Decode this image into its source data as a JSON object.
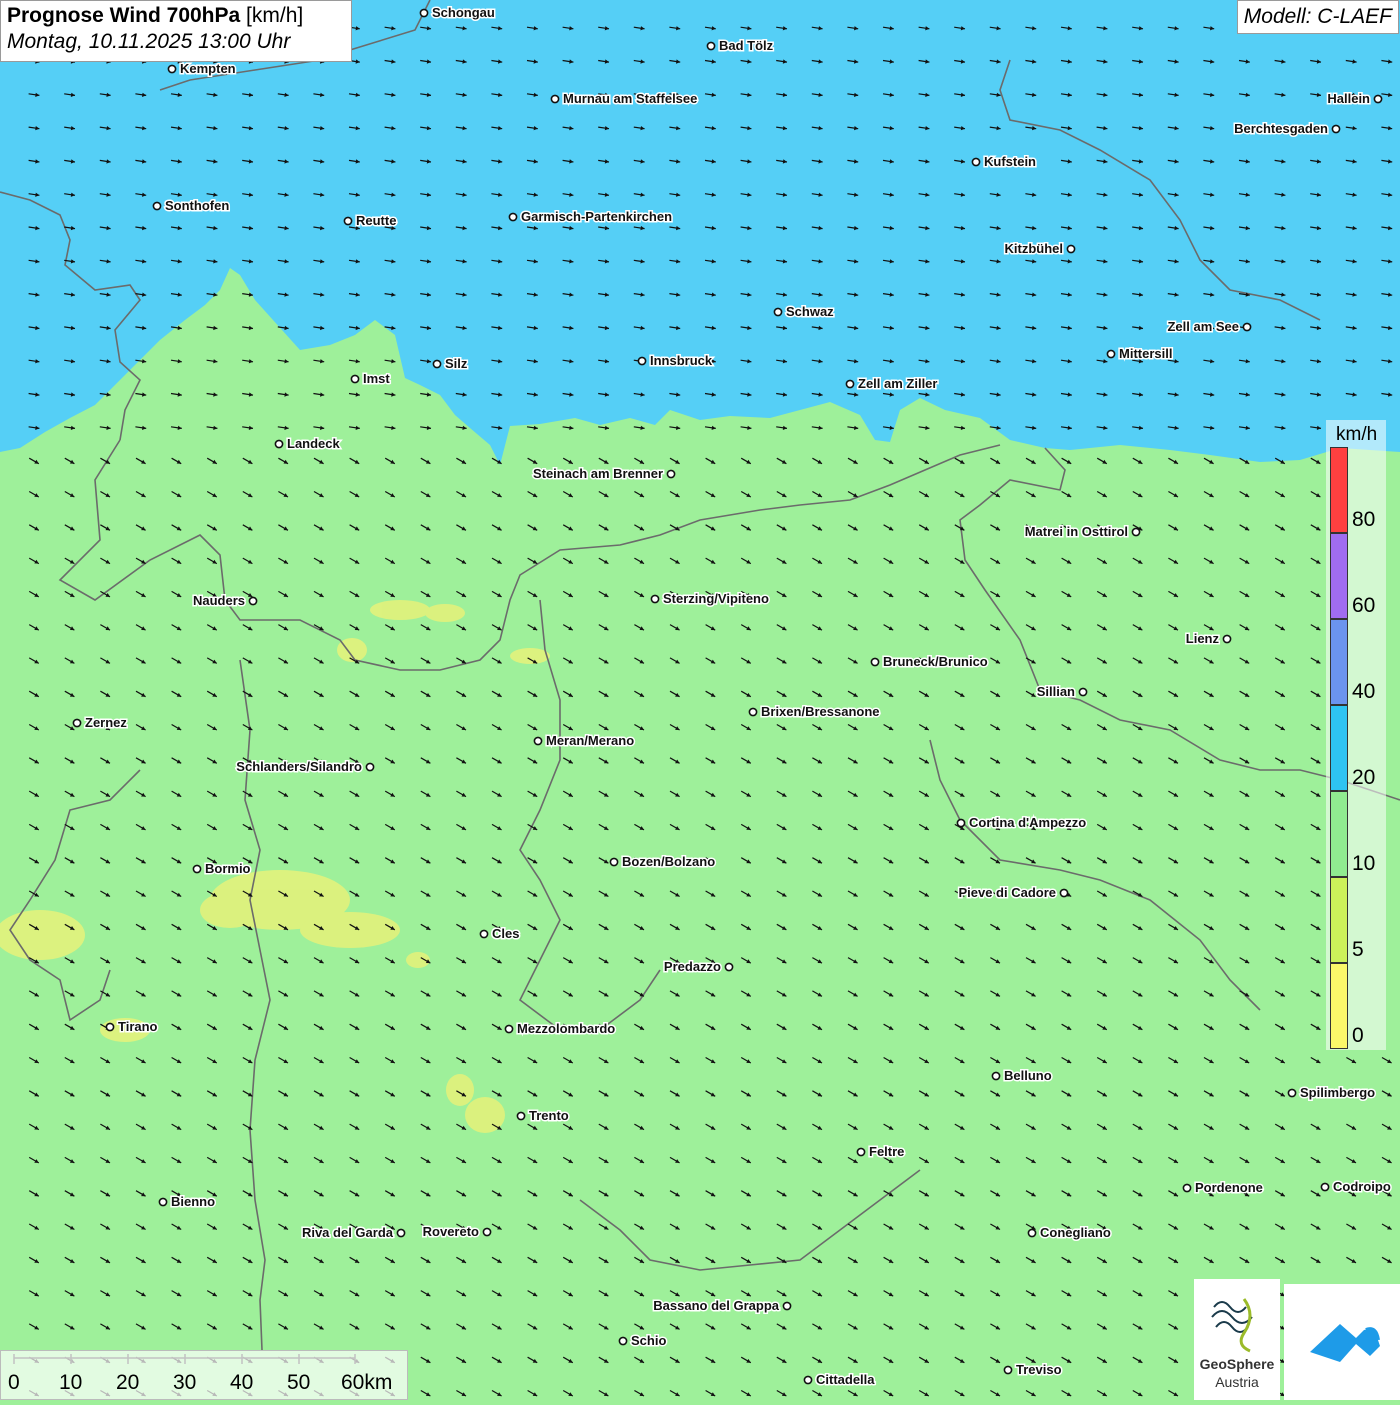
{
  "title": {
    "bold": "Prognose Wind 700hPa",
    "unit": "[km/h]",
    "subtitle": "Montag, 10.11.2025 13:00 Uhr"
  },
  "model": "Modell: C-LAEF",
  "legend": {
    "unit": "km/h",
    "segments": [
      {
        "label": "",
        "color": "#ff4040"
      },
      {
        "label": "80",
        "color": "#a06cf0"
      },
      {
        "label": "60",
        "color": "#6b94ee"
      },
      {
        "label": "40",
        "color": "#2ec4f2"
      },
      {
        "label": "20",
        "color": "#90ec90"
      },
      {
        "label": "10",
        "color": "#ccf25a"
      },
      {
        "label": "5",
        "color": "#fbf86a"
      },
      {
        "label": "0",
        "color": ""
      }
    ]
  },
  "colors": {
    "high_wind_zone": "#55cff6",
    "low_wind_zone": "#9ef09a",
    "calm_patches": "#e6f27a",
    "border_line": "#666666",
    "arrow": "#111111"
  },
  "scalebar": {
    "labels": [
      "0",
      "10",
      "20",
      "30",
      "40",
      "50",
      "60km"
    ]
  },
  "logos": {
    "geosphere_line1": "GeoSphere",
    "geosphere_line2": "Austria"
  },
  "cities": [
    {
      "name": "Schongau"
    },
    {
      "name": "Bad Tölz"
    },
    {
      "name": "Kempten"
    },
    {
      "name": "Murnau am Staffelsee"
    },
    {
      "name": "Hallein"
    },
    {
      "name": "Berchtesgaden"
    },
    {
      "name": "Kufstein"
    },
    {
      "name": "Sonthofen"
    },
    {
      "name": "Reutte"
    },
    {
      "name": "Garmisch-Partenkirchen"
    },
    {
      "name": "Kitzbühel"
    },
    {
      "name": "Schwaz"
    },
    {
      "name": "Zell am See"
    },
    {
      "name": "Mittersill"
    },
    {
      "name": "Innsbruck"
    },
    {
      "name": "Silz"
    },
    {
      "name": "Imst"
    },
    {
      "name": "Zell am Ziller"
    },
    {
      "name": "Landeck"
    },
    {
      "name": "Steinach am Brenner"
    },
    {
      "name": "Matrei in Osttirol"
    },
    {
      "name": "Nauders"
    },
    {
      "name": "Sterzing/Vipiteno"
    },
    {
      "name": "Lienz"
    },
    {
      "name": "Bruneck/Brunico"
    },
    {
      "name": "Sillian"
    },
    {
      "name": "Brixen/Bressanone"
    },
    {
      "name": "Zernez"
    },
    {
      "name": "Meran/Merano"
    },
    {
      "name": "Schlanders/Silandro"
    },
    {
      "name": "Cortina d'Ampezzo"
    },
    {
      "name": "Bozen/Bolzano"
    },
    {
      "name": "Bormio"
    },
    {
      "name": "Pieve di Cadore"
    },
    {
      "name": "Cles"
    },
    {
      "name": "Predazzo"
    },
    {
      "name": "Tirano"
    },
    {
      "name": "Mezzolombardo"
    },
    {
      "name": "Belluno"
    },
    {
      "name": "Spilimbergo"
    },
    {
      "name": "Trento"
    },
    {
      "name": "Feltre"
    },
    {
      "name": "Pordenone"
    },
    {
      "name": "Codroipo"
    },
    {
      "name": "Bienno"
    },
    {
      "name": "Riva del Garda"
    },
    {
      "name": "Rovereto"
    },
    {
      "name": "Conegliano"
    },
    {
      "name": "Bassano del Grappa"
    },
    {
      "name": "Schio"
    },
    {
      "name": "Treviso"
    },
    {
      "name": "Cittadella"
    }
  ]
}
